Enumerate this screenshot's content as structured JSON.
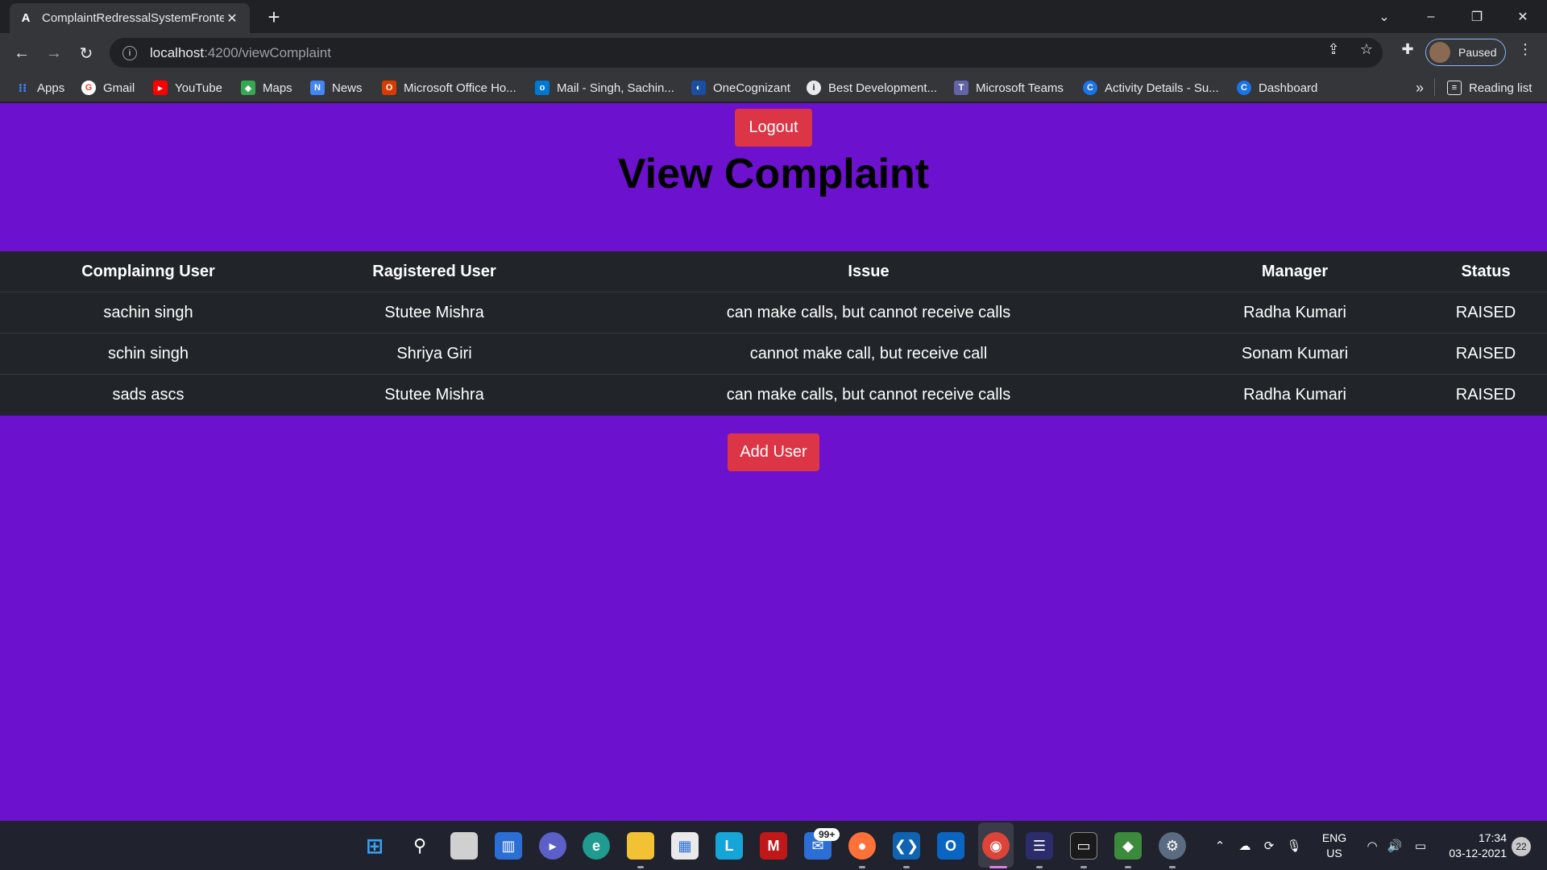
{
  "browser": {
    "tab_title": "ComplaintRedressalSystemFronte",
    "url_host": "localhost",
    "url_path": ":4200/viewComplaint",
    "profile_label": "Paused",
    "bookmarks": [
      {
        "label": "Apps",
        "icon": "apps-grid-icon",
        "color": "#4285f4"
      },
      {
        "label": "Gmail",
        "icon": "google-icon",
        "color": "#ea4335"
      },
      {
        "label": "YouTube",
        "icon": "youtube-icon",
        "color": "#ff0000"
      },
      {
        "label": "Maps",
        "icon": "maps-icon",
        "color": "#34a853"
      },
      {
        "label": "News",
        "icon": "news-icon",
        "color": "#4285f4"
      },
      {
        "label": "Microsoft Office Ho...",
        "icon": "office-icon",
        "color": "#d83b01"
      },
      {
        "label": "Mail - Singh, Sachin...",
        "icon": "outlook-icon",
        "color": "#0078d4"
      },
      {
        "label": "OneCognizant",
        "icon": "onecognizant-icon",
        "color": "#1a4ea1"
      },
      {
        "label": "Best Development...",
        "icon": "bookmark-site-icon",
        "color": "#e8eaed"
      },
      {
        "label": "Microsoft Teams",
        "icon": "teams-icon",
        "color": "#6264a7"
      },
      {
        "label": "Activity Details - Su...",
        "icon": "c-logo-icon",
        "color": "#1a73e8"
      },
      {
        "label": "Dashboard",
        "icon": "c-logo-icon",
        "color": "#1a73e8"
      }
    ],
    "reading_list": "Reading list"
  },
  "page": {
    "logout_label": "Logout",
    "heading": "View Complaint",
    "add_user_label": "Add User",
    "background": "#6c11cd",
    "accent": "#dc3545"
  },
  "table": {
    "headers": [
      "Complainng User",
      "Ragistered User",
      "Issue",
      "Manager",
      "Status"
    ],
    "rows": [
      [
        "sachin singh",
        "Stutee Mishra",
        "can make calls, but cannot receive calls",
        "Radha Kumari",
        "RAISED"
      ],
      [
        "schin singh",
        "Shriya Giri",
        "cannot make call, but receive call",
        "Sonam Kumari",
        "RAISED"
      ],
      [
        "sads ascs",
        "Stutee Mishra",
        "can make calls, but cannot receive calls",
        "Radha Kumari",
        "RAISED"
      ]
    ]
  },
  "taskbar": {
    "mail_badge": "99+",
    "language": "ENG",
    "region": "US",
    "time": "17:34",
    "date": "03-12-2021",
    "notification_count": "22"
  }
}
